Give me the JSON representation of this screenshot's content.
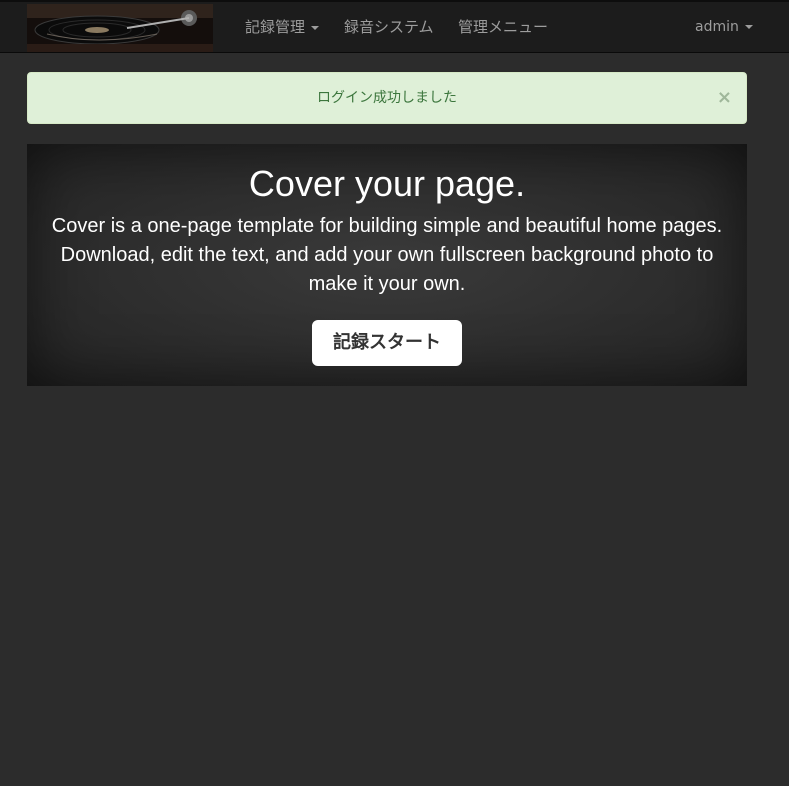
{
  "navbar": {
    "logo_icon": "turntable-image-icon",
    "items": [
      {
        "label": "記録管理",
        "dropdown": true
      },
      {
        "label": "録音システム",
        "dropdown": false
      },
      {
        "label": "管理メニュー",
        "dropdown": false
      }
    ],
    "user": {
      "label": "admin",
      "dropdown": true
    }
  },
  "alert": {
    "message": "ログイン成功しました",
    "close_label": "×"
  },
  "hero": {
    "title": "Cover your page.",
    "lead": "Cover is a one-page template for building simple and beautiful home pages. Download, edit the text, and add your own fullscreen background photo to make it your own.",
    "button_label": "記録スタート"
  },
  "colors": {
    "page_background": "#2c2c2c",
    "navbar_background": "#1c1c1c",
    "alert_background": "#dff0d8",
    "alert_text": "#3c763d"
  }
}
